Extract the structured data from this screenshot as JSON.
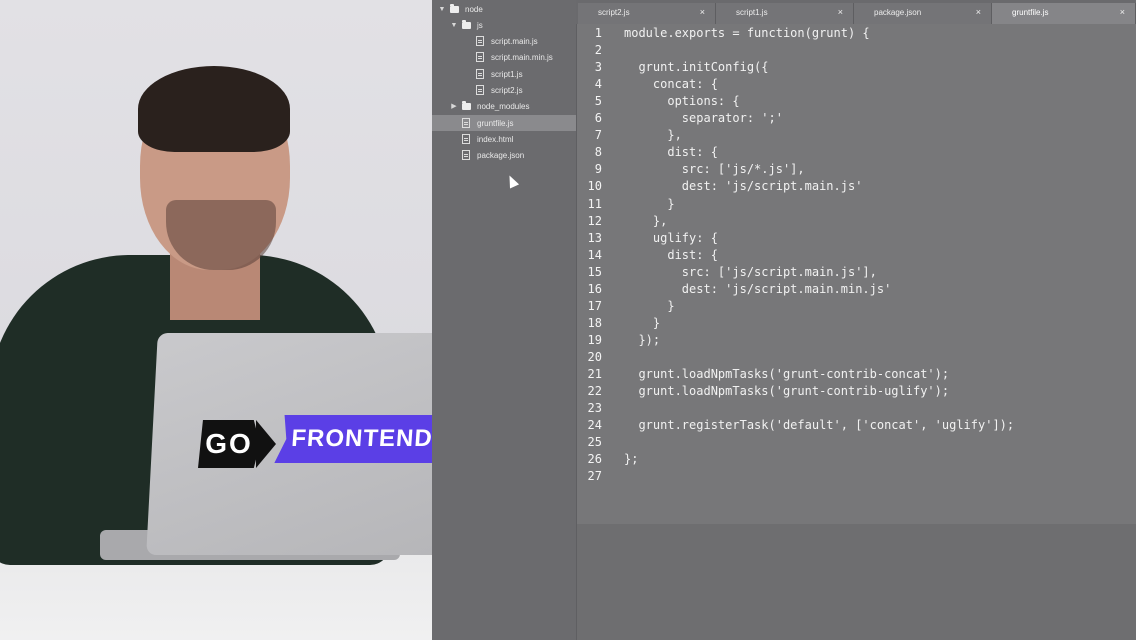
{
  "brand": {
    "part1": "GO",
    "part2": "FRONTEND",
    "accent_color": "#5b3fe6"
  },
  "sidebar": {
    "items": [
      {
        "label": "node",
        "type": "folder",
        "depth": 0,
        "expanded": true
      },
      {
        "label": "js",
        "type": "folder",
        "depth": 1,
        "expanded": true
      },
      {
        "label": "script.main.js",
        "type": "file",
        "depth": 2
      },
      {
        "label": "script.main.min.js",
        "type": "file",
        "depth": 2
      },
      {
        "label": "script1.js",
        "type": "file",
        "depth": 2
      },
      {
        "label": "script2.js",
        "type": "file",
        "depth": 2
      },
      {
        "label": "node_modules",
        "type": "folder",
        "depth": 1,
        "expanded": false
      },
      {
        "label": "gruntfile.js",
        "type": "file",
        "depth": 1,
        "selected": true
      },
      {
        "label": "index.html",
        "type": "file",
        "depth": 1
      },
      {
        "label": "package.json",
        "type": "file",
        "depth": 1
      }
    ]
  },
  "tabs": [
    {
      "label": "script2.js",
      "active": false
    },
    {
      "label": "script1.js",
      "active": false
    },
    {
      "label": "package.json",
      "active": false
    },
    {
      "label": "gruntfile.js",
      "active": true
    }
  ],
  "tab_close_glyph": "×",
  "editor": {
    "lines": [
      {
        "n": "1",
        "text": "module.exports = function(grunt) {"
      },
      {
        "n": "2",
        "text": ""
      },
      {
        "n": "3",
        "text": "  grunt.initConfig({"
      },
      {
        "n": "4",
        "text": "    concat: {"
      },
      {
        "n": "5",
        "text": "      options: {"
      },
      {
        "n": "6",
        "text": "        separator: ';'"
      },
      {
        "n": "7",
        "text": "      },"
      },
      {
        "n": "8",
        "text": "      dist: {"
      },
      {
        "n": "9",
        "text": "        src: ['js/*.js'],"
      },
      {
        "n": "10",
        "text": "        dest: 'js/script.main.js'"
      },
      {
        "n": "11",
        "text": "      }"
      },
      {
        "n": "12",
        "text": "    },"
      },
      {
        "n": "13",
        "text": "    uglify: {"
      },
      {
        "n": "14",
        "text": "      dist: {"
      },
      {
        "n": "15",
        "text": "        src: ['js/script.main.js'],"
      },
      {
        "n": "16",
        "text": "        dest: 'js/script.main.min.js'"
      },
      {
        "n": "17",
        "text": "      }"
      },
      {
        "n": "18",
        "text": "    }"
      },
      {
        "n": "19",
        "text": "  });"
      },
      {
        "n": "20",
        "text": ""
      },
      {
        "n": "21",
        "text": "  grunt.loadNpmTasks('grunt-contrib-concat');"
      },
      {
        "n": "22",
        "text": "  grunt.loadNpmTasks('grunt-contrib-uglify');"
      },
      {
        "n": "23",
        "text": ""
      },
      {
        "n": "24",
        "text": "  grunt.registerTask('default', ['concat', 'uglify']);"
      },
      {
        "n": "25",
        "text": ""
      },
      {
        "n": "26",
        "text": "};"
      },
      {
        "n": "27",
        "text": ""
      }
    ]
  }
}
